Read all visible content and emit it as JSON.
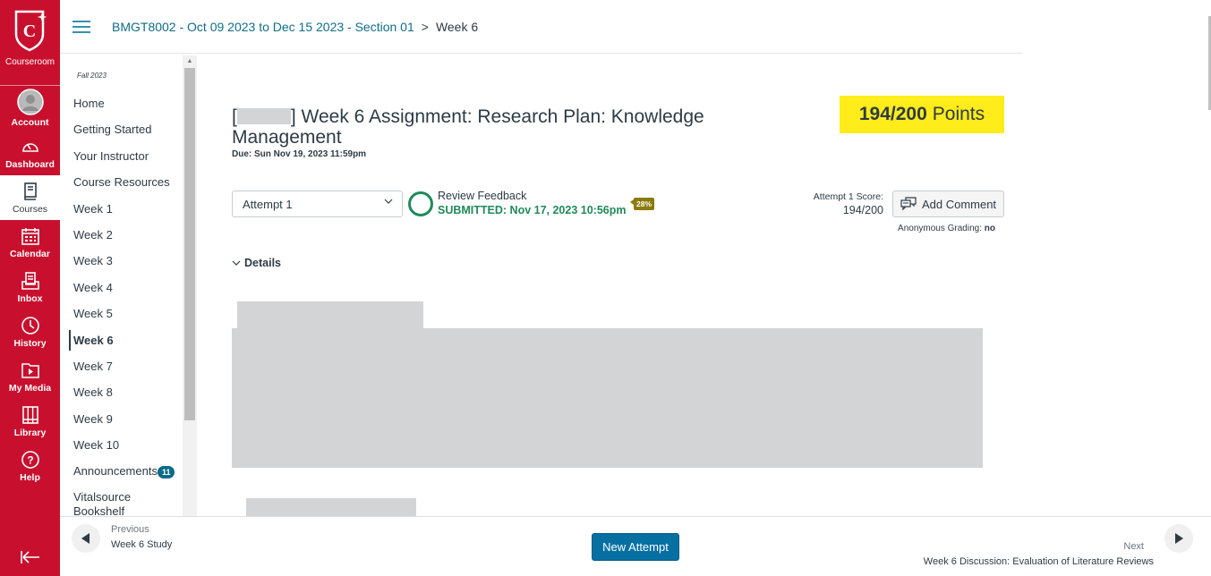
{
  "global_nav": {
    "brand": "Courseroom",
    "items": [
      {
        "label": "Account",
        "icon": "user-avatar-icon"
      },
      {
        "label": "Dashboard",
        "icon": "speedometer-icon"
      },
      {
        "label": "Courses",
        "icon": "book-icon",
        "active": true
      },
      {
        "label": "Calendar",
        "icon": "calendar-icon"
      },
      {
        "label": "Inbox",
        "icon": "inbox-icon"
      },
      {
        "label": "History",
        "icon": "clock-icon"
      },
      {
        "label": "My Media",
        "icon": "media-folder-icon"
      },
      {
        "label": "Library",
        "icon": "library-icon"
      },
      {
        "label": "Help",
        "icon": "help-icon"
      }
    ],
    "collapse_icon": "collapse-arrow-icon"
  },
  "header": {
    "course": "BMGT8002 - Oct 09 2023 to Dec 15 2023 - Section 01",
    "separator": ">",
    "current": "Week 6"
  },
  "course_nav": {
    "term": "Fall 2023",
    "items": [
      {
        "label": "Home"
      },
      {
        "label": "Getting Started"
      },
      {
        "label": "Your Instructor"
      },
      {
        "label": "Course Resources"
      },
      {
        "label": "Week 1"
      },
      {
        "label": "Week 2"
      },
      {
        "label": "Week 3"
      },
      {
        "label": "Week 4"
      },
      {
        "label": "Week 5"
      },
      {
        "label": "Week 6",
        "active": true
      },
      {
        "label": "Week 7"
      },
      {
        "label": "Week 8"
      },
      {
        "label": "Week 9"
      },
      {
        "label": "Week 10"
      },
      {
        "label": "Announcements",
        "badge": "11"
      },
      {
        "label": "Vitalsource Bookshelf"
      }
    ]
  },
  "assignment": {
    "title_prefix": "[",
    "title_suffix": "] Week 6 Assignment: Research Plan: Knowledge Management",
    "due": "Due: Sun Nov 19, 2023 11:59pm",
    "points_score": "194/200",
    "points_label": "Points",
    "attempt_select": "Attempt 1",
    "review_feedback": "Review Feedback",
    "submitted": "SUBMITTED: Nov 17, 2023 10:56pm",
    "similarity_pct": "28%",
    "attempt_score_label": "Attempt 1 Score:",
    "attempt_score_value": "194/200",
    "add_comment": "Add Comment",
    "anonymous_grading_label": "Anonymous Grading:",
    "anonymous_grading_value": "no",
    "details": "Details"
  },
  "footer": {
    "previous_label": "Previous",
    "previous_title": "Week 6 Study",
    "new_attempt": "New Attempt",
    "next_label": "Next",
    "next_title": "Week 6 Discussion: Evaluation of Literature Reviews"
  },
  "colors": {
    "brand_red": "#c8102e",
    "link_teal": "#0f6e87",
    "success_green": "#1f8a5a",
    "highlight_yellow": "#ffec1a",
    "primary_button": "#0770a3"
  }
}
